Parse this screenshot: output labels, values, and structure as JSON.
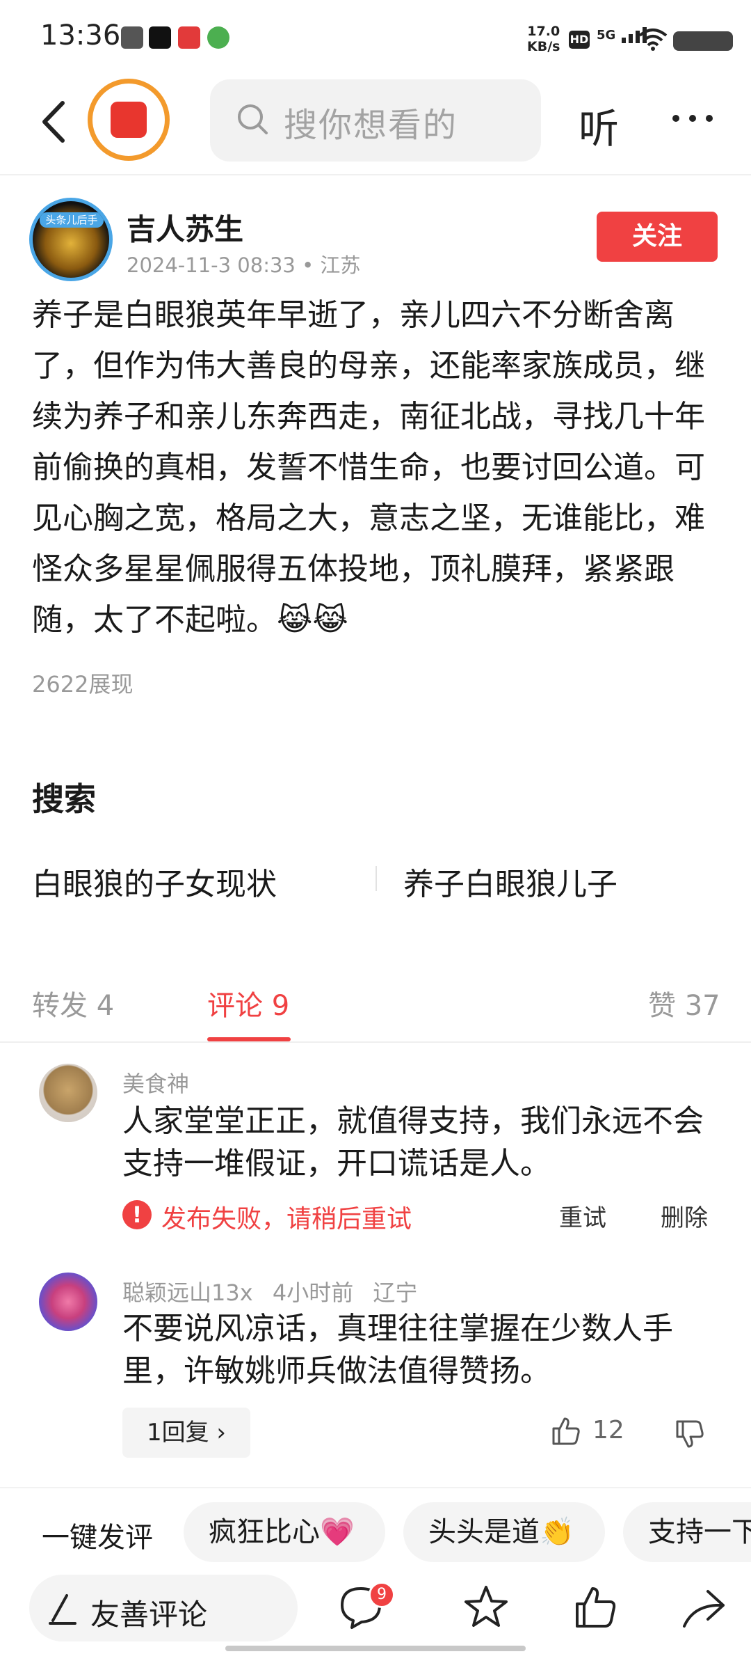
{
  "status_bar": {
    "time": "13:36",
    "net_speed_value": "17.0",
    "net_speed_unit": "KB/s",
    "hd_label": "HD",
    "signal_label": "5G"
  },
  "nav": {
    "search_placeholder": "搜你想看的",
    "listen_label": "听"
  },
  "post": {
    "author": "吉人苏生",
    "avatar_text": "头条儿后手",
    "meta": "2024-11-3 08:33 • 江苏",
    "follow_label": "关注",
    "body": "养子是白眼狼英年早逝了，亲儿四六不分断舍离了，但作为伟大善良的母亲，还能率家族成员，继续为养子和亲儿东奔西走，南征北战，寻找几十年前偷换的真相，发誓不惜生命，也要讨回公道。可见心胸之宽，格局之大，意志之坚，无谁能比，难怪众多星星佩服得五体投地，顶礼膜拜，紧紧跟随，太了不起啦。😹😹",
    "views": "2622展现"
  },
  "search_section": {
    "title": "搜索",
    "suggestions": [
      "白眼狼的子女现状",
      "养子白眼狼儿子"
    ]
  },
  "tabs": {
    "repost": "转发 4",
    "comments": "评论 9",
    "likes": "赞 37"
  },
  "comments": [
    {
      "name": "美食神",
      "text": "人家堂堂正正，就值得支持，我们永远不会支持一堆假证，开口谎话是人。",
      "fail_text": "发布失败，请稍后重试",
      "retry_label": "重试",
      "delete_label": "删除"
    },
    {
      "name": "聪颖远山13x",
      "time": "4小时前",
      "location": "辽宁",
      "text": "不要说风凉话，真理往往掌握在少数人手里，许敏姚师兵做法值得赞扬。",
      "reply_label": "1回复 ›",
      "like_count": "12"
    }
  ],
  "quick_comment": {
    "label": "一键发评",
    "chips": [
      "疯狂比心💗",
      "头头是道👏",
      "支持一下"
    ]
  },
  "bottom_bar": {
    "input_label": "友善评论",
    "comment_badge": "9"
  },
  "colors": {
    "accent_red": "#f04142",
    "follow_bg": "#f04142",
    "redpacket_ring": "#f39a2c"
  }
}
